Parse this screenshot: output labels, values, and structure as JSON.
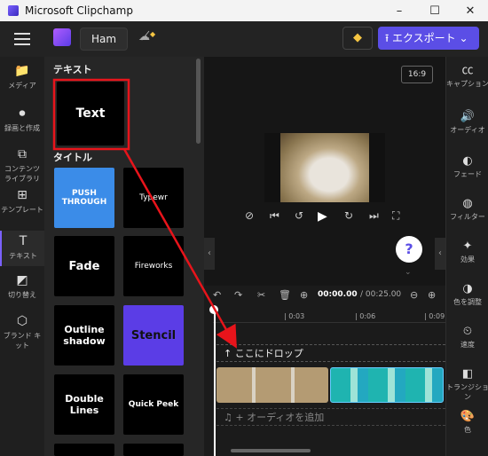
{
  "window": {
    "title": "Microsoft Clipchamp",
    "minimize": "–",
    "maximize": "☐",
    "close": "✕"
  },
  "topbar": {
    "project_name": "Ham",
    "export_label": "⭱ エクスポート ⌄",
    "premium_icon": "diamond-icon"
  },
  "left_nav": [
    {
      "label": "メディア",
      "icon": "📁"
    },
    {
      "label": "録画と作成",
      "icon": "⏺"
    },
    {
      "label": "コンテンツ ライブラリ",
      "icon": "⧉"
    },
    {
      "label": "テンプレート",
      "icon": "⊞"
    },
    {
      "label": "テキスト",
      "icon": "T"
    },
    {
      "label": "切り替え",
      "icon": "◩"
    },
    {
      "label": "ブランド キット",
      "icon": "⬡"
    }
  ],
  "panel": {
    "section_text": "テキスト",
    "section_title": "タイトル",
    "text_tile": "Text",
    "tiles": [
      {
        "label": "PUSH THROUGH"
      },
      {
        "label": "Typewr"
      },
      {
        "label": "Fade"
      },
      {
        "label": "Fireworks"
      },
      {
        "label": "Outline shadow"
      },
      {
        "label": "Stencil"
      },
      {
        "label": "Double Lines"
      },
      {
        "label": "Quick Peek"
      }
    ]
  },
  "preview": {
    "aspect_ratio": "16:9",
    "help": "?"
  },
  "timeline": {
    "current_time": "00:00.00",
    "total_time": "/ 00:25.00",
    "ticks": [
      "| 0:03",
      "| 0:06",
      "| 0:09"
    ],
    "drop_label": "↑  ここにドロップ",
    "audio_label": "♫  + オーディオを追加"
  },
  "right_nav": [
    {
      "label": "キャプション",
      "icon": "㏄"
    },
    {
      "label": "オーディオ",
      "icon": "🔊"
    },
    {
      "label": "フェード",
      "icon": "◐"
    },
    {
      "label": "フィルター",
      "icon": "◍"
    },
    {
      "label": "効果",
      "icon": "✦"
    },
    {
      "label": "色を調整",
      "icon": "◑"
    },
    {
      "label": "速度",
      "icon": "⏲"
    },
    {
      "label": "トランジション",
      "icon": "◧"
    },
    {
      "label": "色",
      "icon": "🎨"
    }
  ],
  "colors": {
    "accent": "#5b4ee6",
    "annotation": "#e8141b",
    "stencil": "#5b3de6",
    "push_through": "#3b8ce8"
  }
}
